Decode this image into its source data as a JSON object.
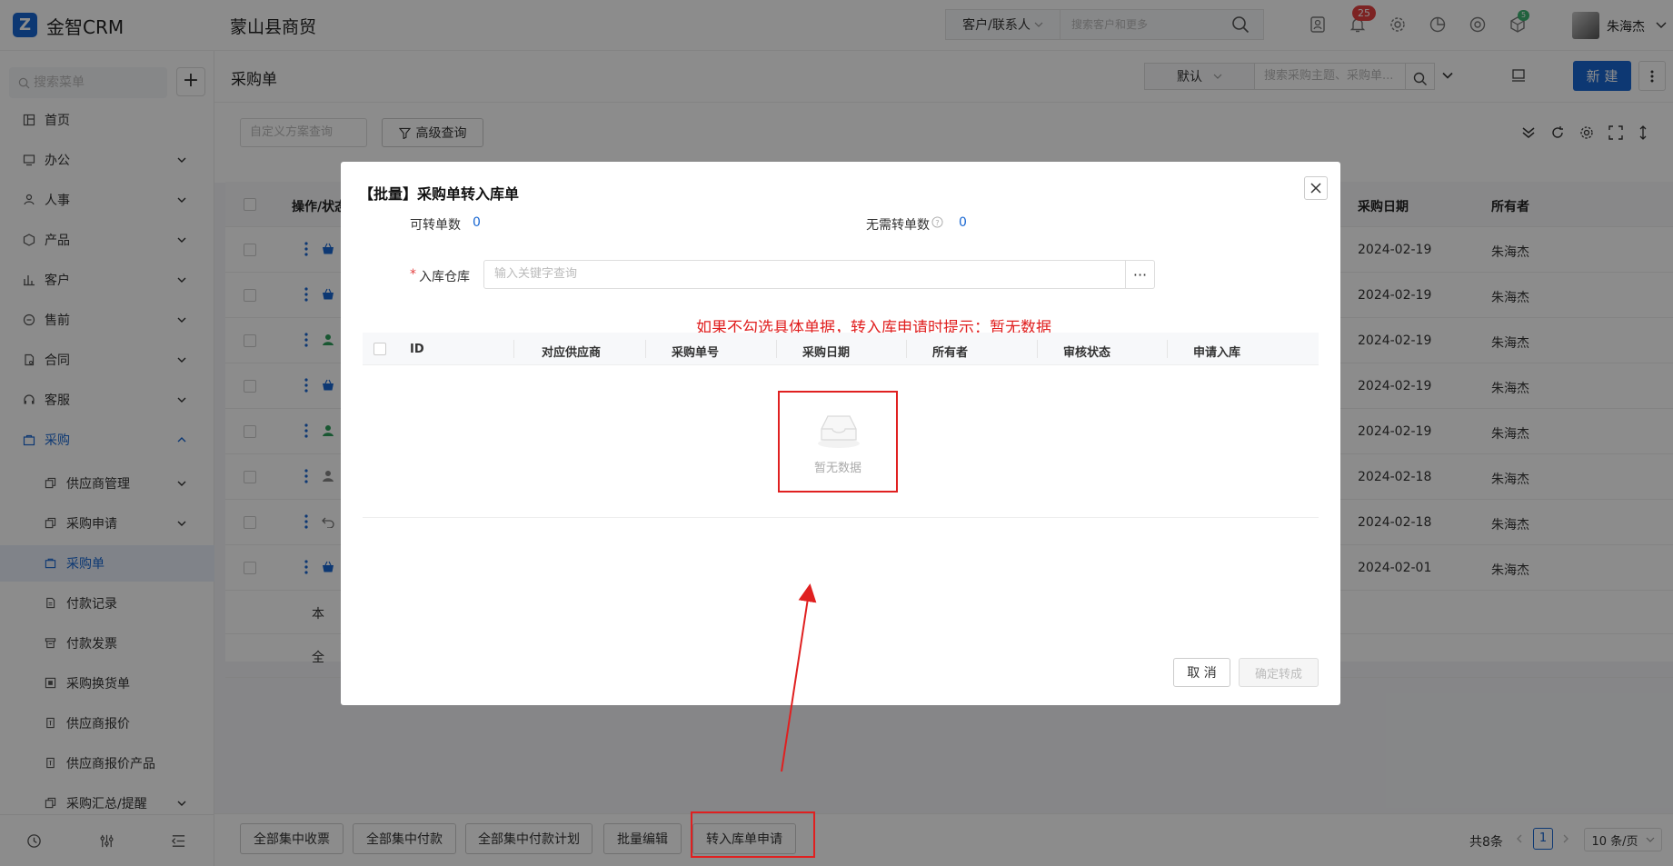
{
  "app": {
    "logo_letter": "Z",
    "name": "金智CRM",
    "company": "蒙山县商贸"
  },
  "topbar": {
    "customer_select": "客户/联系人",
    "search_placeholder": "搜索客户和更多",
    "notification_count": "25",
    "badge_small": "5",
    "user_name": "朱海杰",
    "icons": [
      "search-icon",
      "contacts-icon",
      "bell-icon",
      "gear-icon",
      "pie-chart-icon",
      "chrome-icon",
      "cube-icon",
      "chevron-down-icon"
    ]
  },
  "sidebar": {
    "search_placeholder": "搜索菜单",
    "add_label": "+",
    "items": [
      {
        "label": "首页",
        "icon": "home-icon"
      },
      {
        "label": "办公",
        "icon": "office-icon"
      },
      {
        "label": "人事",
        "icon": "people-icon"
      },
      {
        "label": "产品",
        "icon": "box-icon"
      },
      {
        "label": "客户",
        "icon": "chart-bar-icon"
      },
      {
        "label": "售前",
        "icon": "presale-icon"
      },
      {
        "label": "合同",
        "icon": "contract-icon"
      },
      {
        "label": "客服",
        "icon": "headset-icon"
      },
      {
        "label": "采购",
        "icon": "purchase-icon"
      }
    ],
    "sub_items": [
      {
        "label": "供应商管理",
        "icon": "copy-icon"
      },
      {
        "label": "采购申请",
        "icon": "copy-icon"
      },
      {
        "label": "采购单",
        "icon": "bag-icon"
      },
      {
        "label": "付款记录",
        "icon": "doc-icon"
      },
      {
        "label": "付款发票",
        "icon": "invoice-icon"
      },
      {
        "label": "采购换货单",
        "icon": "exchange-icon"
      },
      {
        "label": "供应商报价",
        "icon": "quote-icon"
      },
      {
        "label": "供应商报价产品",
        "icon": "quote-icon"
      },
      {
        "label": "采购汇总/提醒",
        "icon": "copy-icon"
      }
    ]
  },
  "page": {
    "title": "采购单",
    "view_select": "默认",
    "search_placeholder": "搜索采购主题、采购单...",
    "new_button": "新 建",
    "custom_query_placeholder": "自定义方案查询",
    "advanced_query": "高级查询"
  },
  "table": {
    "headers": {
      "ops": "操作/状态",
      "purchase_date": "采购日期",
      "owner": "所有者"
    },
    "rows": [
      {
        "date": "2024-02-19",
        "owner": "朱海杰",
        "status_icon": "basket-icon"
      },
      {
        "date": "2024-02-19",
        "owner": "朱海杰",
        "status_icon": "basket-icon"
      },
      {
        "date": "2024-02-19",
        "owner": "朱海杰",
        "status_icon": "user-icon"
      },
      {
        "date": "2024-02-19",
        "owner": "朱海杰",
        "status_icon": "basket-icon"
      },
      {
        "date": "2024-02-19",
        "owner": "朱海杰",
        "status_icon": "user-icon"
      },
      {
        "date": "2024-02-18",
        "owner": "朱海杰",
        "status_icon": "user-grey-icon"
      },
      {
        "date": "2024-02-18",
        "owner": "朱海杰",
        "status_icon": "undo-icon"
      },
      {
        "date": "2024-02-01",
        "owner": "朱海杰",
        "status_icon": "basket-icon"
      }
    ],
    "footer_rows": [
      "本",
      "全"
    ]
  },
  "bottom_bar": {
    "buttons": [
      "全部集中收票",
      "全部集中付款",
      "全部集中付款计划",
      "批量编辑",
      "转入库单申请"
    ],
    "total": "共8条",
    "current_page": "1",
    "page_size": "10 条/页"
  },
  "dialog": {
    "title": "【批量】采购单转入库单",
    "convertible_label": "可转单数",
    "convertible_value": "0",
    "no_need_label": "无需转单数",
    "no_need_value": "0",
    "warehouse_label": "入库仓库",
    "warehouse_required": "*",
    "warehouse_placeholder": "输入关键字查询",
    "warehouse_more": "···",
    "columns": [
      "ID",
      "对应供应商",
      "采购单号",
      "采购日期",
      "所有者",
      "审核状态",
      "申请入库"
    ],
    "empty_text": "暂无数据",
    "cancel": "取 消",
    "confirm": "确定转成"
  },
  "annotation": {
    "text": "如果不勾选具体单据，转入库申请时提示：暂无数据",
    "color": "#e02020"
  },
  "colors": {
    "primary": "#1967d2",
    "badge": "#e34141",
    "annotation": "#e02020"
  }
}
